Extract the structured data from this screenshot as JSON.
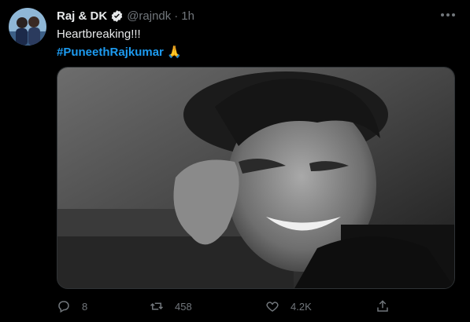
{
  "tweet": {
    "display_name": "Raj & DK",
    "handle": "@rajndk",
    "separator": "·",
    "time": "1h",
    "text_line1": "Heartbreaking!!!",
    "hashtag": "#PuneethRajkumar",
    "emoji": "🙏",
    "image_icon": "photo",
    "verified_icon": "verified-badge-icon"
  },
  "actions": {
    "replies": "8",
    "retweets": "458",
    "likes": "4.2K"
  },
  "colors": {
    "background": "#000000",
    "text": "#e7e9ea",
    "muted": "#71767b",
    "link": "#1d9bf0"
  }
}
